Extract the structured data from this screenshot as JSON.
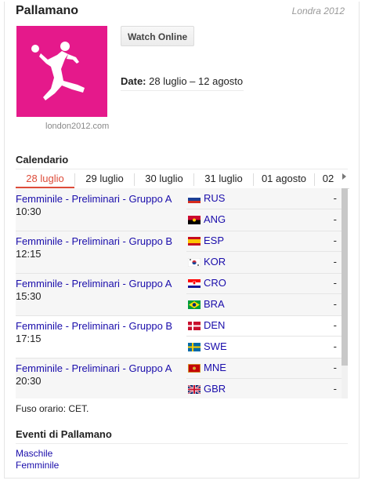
{
  "header": {
    "title": "Pallamano",
    "subtitle": "Londra 2012"
  },
  "logo": {
    "caption": "london2012.com",
    "color": "#e5198b"
  },
  "actions": {
    "watch_label": "Watch Online"
  },
  "dates": {
    "label": "Date:",
    "value": "28 luglio – 12 agosto"
  },
  "calendar": {
    "heading": "Calendario",
    "tabs": [
      "28 luglio",
      "29 luglio",
      "30 luglio",
      "31 luglio",
      "01 agosto",
      "02"
    ],
    "active_tab": 0,
    "matches": [
      {
        "event": "Femminile - Preliminari - Gruppo A",
        "time": "10:30",
        "teams": [
          {
            "code": "RUS",
            "flag": "russia-flag",
            "score": "-"
          },
          {
            "code": "ANG",
            "flag": "angola-flag",
            "score": "-"
          }
        ]
      },
      {
        "event": "Femminile - Preliminari - Gruppo B",
        "time": "12:15",
        "teams": [
          {
            "code": "ESP",
            "flag": "spain-flag",
            "score": "-"
          },
          {
            "code": "KOR",
            "flag": "korea-flag",
            "score": "-"
          }
        ]
      },
      {
        "event": "Femminile - Preliminari - Gruppo A",
        "time": "15:30",
        "teams": [
          {
            "code": "CRO",
            "flag": "croatia-flag",
            "score": "-"
          },
          {
            "code": "BRA",
            "flag": "brazil-flag",
            "score": "-"
          }
        ]
      },
      {
        "event": "Femminile - Preliminari - Gruppo B",
        "time": "17:15",
        "teams": [
          {
            "code": "DEN",
            "flag": "denmark-flag",
            "score": "-"
          },
          {
            "code": "SWE",
            "flag": "sweden-flag",
            "score": "-"
          }
        ]
      },
      {
        "event": "Femminile - Preliminari - Gruppo A",
        "time": "20:30",
        "teams": [
          {
            "code": "MNE",
            "flag": "montenegro-flag",
            "score": "-"
          },
          {
            "code": "GBR",
            "flag": "uk-flag",
            "score": "-"
          }
        ]
      }
    ],
    "timezone": "Fuso orario: CET."
  },
  "events": {
    "heading": "Eventi di Pallamano",
    "links": [
      "Maschile",
      "Femminile"
    ]
  }
}
